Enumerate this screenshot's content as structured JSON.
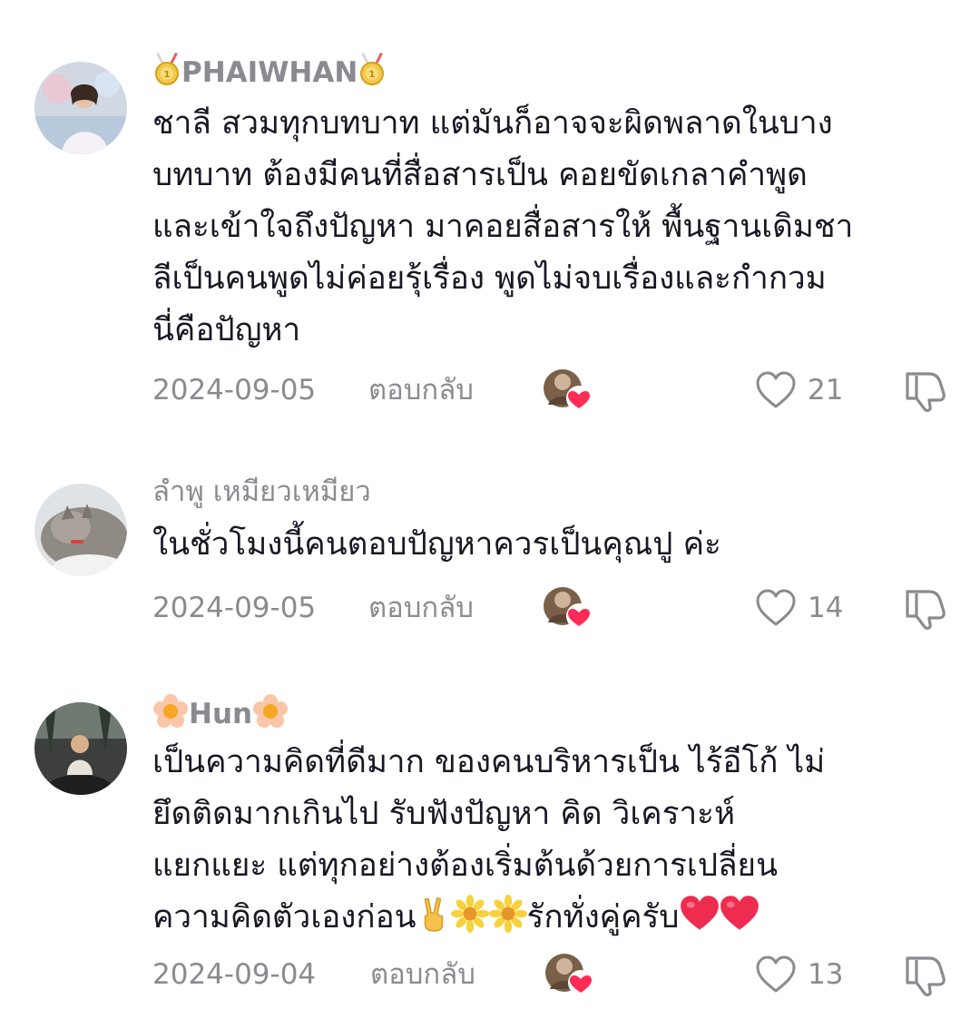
{
  "comments": [
    {
      "username": "PHAIWHAN",
      "username_prefix_icon": "medal-icon",
      "username_suffix_icon": "medal-icon",
      "text_lines": [
        "ชาลี สวมทุกบทบาท แต่มันก็อาจจะผิดพลาดในบาง",
        "บทบาท ต้องมีคนที่สื่อสารเป็น คอยขัดเกลาคำพูด",
        "และเข้าใจถึงปัญหา มาคอยสื่อสารให้ พื้นฐานเดิมชา",
        "ลีเป็นคนพูดไม่ค่อยรุ้เรื่อง พูดไม่จบเรื่องและกำกวม",
        "นี่คือปัญหา"
      ],
      "date": "2024-09-05",
      "reply_label": "ตอบกลับ",
      "like_count": "21"
    },
    {
      "username": "ลำพู เหมียวเหมียว",
      "text_lines": [
        "ในชั่วโมงนี้คนตอบปัญหาควรเป็นคุณปู ค่ะ"
      ],
      "date": "2024-09-05",
      "reply_label": "ตอบกลับ",
      "like_count": "14"
    },
    {
      "username": "Hun",
      "username_prefix_icon": "flower-icon",
      "username_suffix_icon": "flower-icon",
      "text_lines": [
        "เป็นความคิดที่ดีมาก ของคนบริหารเป็น ไร้อีโก้ ไม่",
        "ยึดติดมากเกินไป รับฟังปัญหา คิด วิเคราะห์",
        "แยกแยะ แต่ทุกอย่างต้องเริ่มต้นด้วยการเปลี่ยน",
        "ความคิดตัวเองก่อน",
        "รักทั่งคู่ครับ"
      ],
      "date": "2024-09-04",
      "reply_label": "ตอบกลับ",
      "like_count": "13"
    }
  ],
  "colors": {
    "primary_text": "#161823",
    "secondary_text": "#8a8b91",
    "heart_red": "#fe2c55"
  }
}
